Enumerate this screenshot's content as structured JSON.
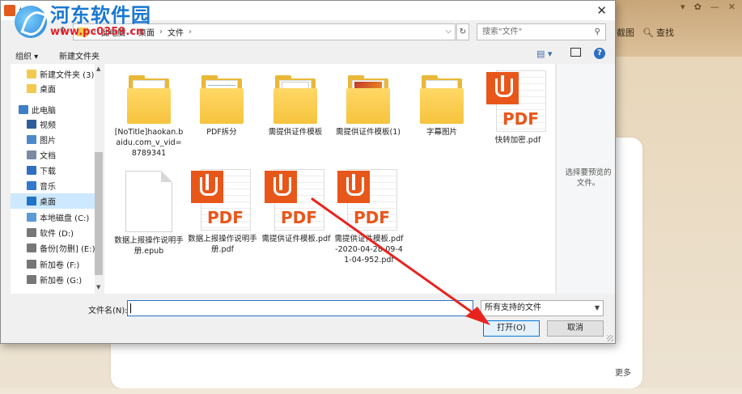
{
  "watermark": {
    "site_name": "河东软件园",
    "url": "www.pc0359.cn"
  },
  "background_app": {
    "window_controls": [
      "▾",
      "✿",
      "—",
      "✕"
    ],
    "tools": [
      {
        "icon": "screenshot-icon",
        "label": "截图"
      },
      {
        "icon": "search-icon",
        "label": "查找"
      }
    ],
    "more_label": "更多"
  },
  "dialog": {
    "title": "打开",
    "close_label": "✕",
    "address": {
      "crumbs": [
        "此电脑",
        "桌面",
        "文件"
      ]
    },
    "search_placeholder": "搜索\"文件\"",
    "toolbar": {
      "organize_label": "组织 ▾",
      "new_folder_label": "新建文件夹"
    },
    "nav_items": [
      {
        "label": "新建文件夹 (3)",
        "icon": "folder-icon",
        "color": "#f4c94f",
        "indent": 1
      },
      {
        "label": "桌面",
        "icon": "folder-icon",
        "color": "#f4c94f",
        "indent": 1
      },
      {
        "label": "此电脑",
        "icon": "computer-icon",
        "color": "#3f7fc9",
        "indent": 0
      },
      {
        "label": "视频",
        "icon": "video-icon",
        "color": "#2d5e99",
        "indent": 1
      },
      {
        "label": "图片",
        "icon": "pictures-icon",
        "color": "#4c89c9",
        "indent": 1
      },
      {
        "label": "文档",
        "icon": "documents-icon",
        "color": "#7a8ca5",
        "indent": 1
      },
      {
        "label": "下载",
        "icon": "download-icon",
        "color": "#2f6fc2",
        "indent": 1
      },
      {
        "label": "音乐",
        "icon": "music-icon",
        "color": "#3279cc",
        "indent": 1
      },
      {
        "label": "桌面",
        "icon": "desktop-icon",
        "color": "#1f73c9",
        "indent": 1,
        "selected": true
      },
      {
        "label": "本地磁盘 (C:)",
        "icon": "drive-c-icon",
        "color": "#5b9bd5",
        "indent": 1
      },
      {
        "label": "软件 (D:)",
        "icon": "drive-icon",
        "color": "#777777",
        "indent": 1
      },
      {
        "label": "备份[勿删] (E:)",
        "icon": "drive-icon",
        "color": "#777777",
        "indent": 1
      },
      {
        "label": "新加卷 (F:)",
        "icon": "drive-icon",
        "color": "#777777",
        "indent": 1
      },
      {
        "label": "新加卷 (G:)",
        "icon": "drive-icon",
        "color": "#777777",
        "indent": 1
      }
    ],
    "files": [
      {
        "name": "[NoTitle]haokan.baidu.com_v_vid=8789341",
        "type": "folder",
        "thumb": ""
      },
      {
        "name": "PDF拆分",
        "type": "folder",
        "thumb": "doc"
      },
      {
        "name": "需提供证件模板",
        "type": "folder",
        "thumb": "id"
      },
      {
        "name": "需提供证件模板(1)",
        "type": "folder",
        "thumb": "photo"
      },
      {
        "name": "字幕图片",
        "type": "folder",
        "thumb": ""
      },
      {
        "name": "快转加密.pdf",
        "type": "pdf"
      },
      {
        "name": "数据上报操作说明手册.epub",
        "type": "blank"
      },
      {
        "name": "数据上报操作说明手册.pdf",
        "type": "pdf"
      },
      {
        "name": "需提供证件模板.pdf",
        "type": "pdf"
      },
      {
        "name": "需提供证件模板.pdf-2020-04-28-09-41-04-952.pdf",
        "type": "pdf"
      }
    ],
    "pdf_badge_text": "PDF",
    "preview_text": "选择要预览的文件。",
    "filename_label": "文件名(N):",
    "filename_value": "",
    "filter_value": "所有支持的文件",
    "open_label": "打开(O)",
    "cancel_label": "取消"
  },
  "colors": {
    "accent": "#0078d7",
    "annotation_arrow": "#e8231e",
    "pdf": "#e8571a"
  }
}
